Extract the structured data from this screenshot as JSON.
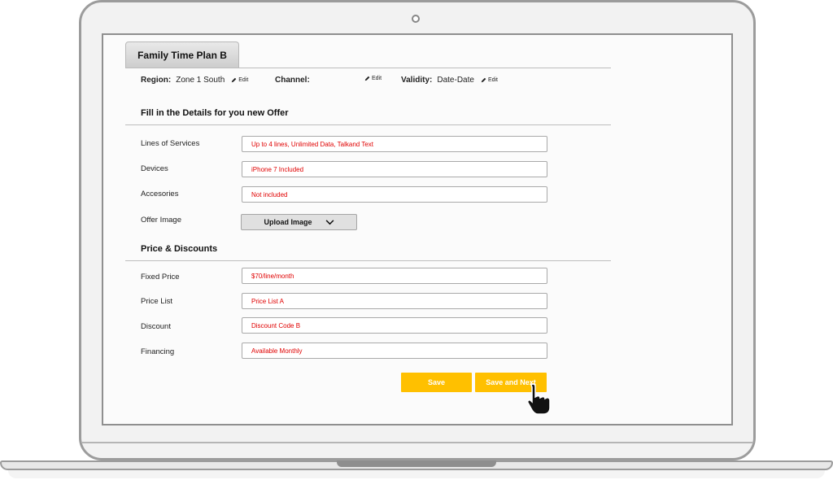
{
  "tab": {
    "title": "Family Time Plan B"
  },
  "meta": {
    "region_label": "Region:",
    "region_value": "Zone 1 South",
    "channel_label": "Channel:",
    "channel_value": "",
    "validity_label": "Validity:",
    "validity_value": "Date-Date",
    "edit_label": "Edit"
  },
  "details_section": {
    "title": "Fill in the Details for you new Offer",
    "fields": [
      {
        "label": "Lines of Services",
        "value": "Up to 4 lines, Unlimited Data, Talkand Text"
      },
      {
        "label": "Devices",
        "value": "iPhone 7 Included"
      },
      {
        "label": "Accesories",
        "value": "Not included"
      }
    ],
    "offer_image_label": "Offer Image",
    "upload_label": "Upload Image"
  },
  "price_section": {
    "title": "Price & Discounts",
    "fields": [
      {
        "label": "Fixed Price",
        "value": "$70/line/month"
      },
      {
        "label": "Price List",
        "value": "Price List A"
      },
      {
        "label": "Discount",
        "value": "Discount Code B"
      },
      {
        "label": "Financing",
        "value": "Available Monthly"
      }
    ]
  },
  "actions": {
    "save_label": "Save",
    "save_next_label": "Save and Next"
  },
  "colors": {
    "accent": "#ffc000",
    "input_text": "#e00000",
    "frame": "#9c9c9c"
  }
}
